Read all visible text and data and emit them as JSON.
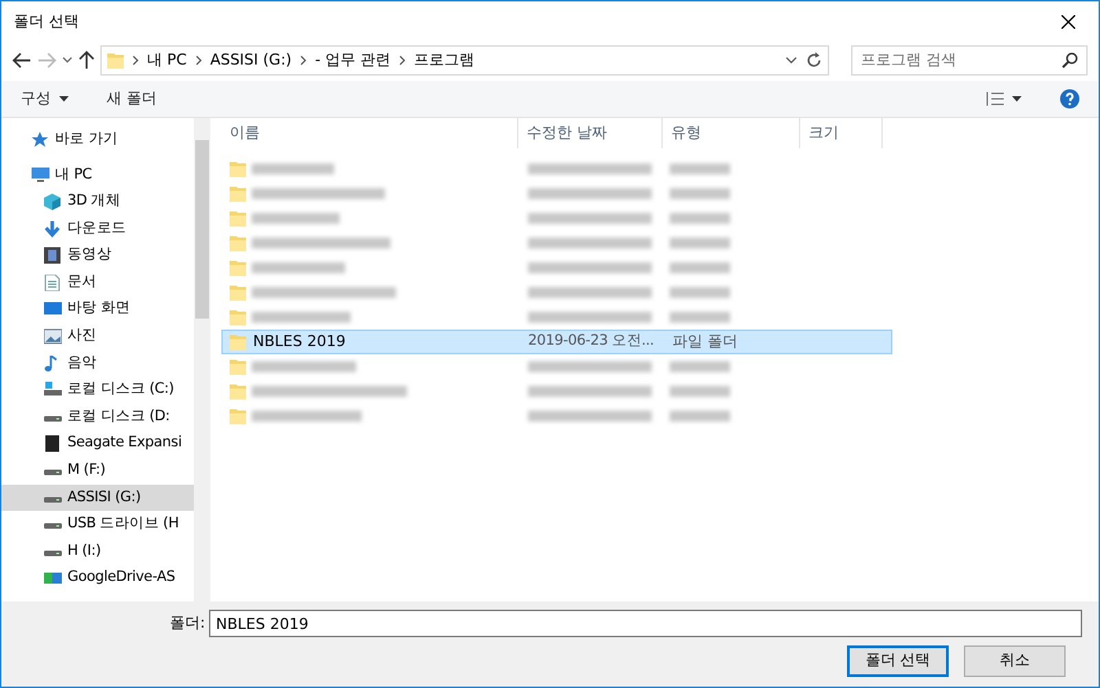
{
  "window": {
    "title": "폴더 선택"
  },
  "breadcrumb": [
    "내 PC",
    "ASSISI (G:)",
    "- 업무 관련",
    "프로그램"
  ],
  "search": {
    "placeholder": "프로그램 검색"
  },
  "toolbar": {
    "organize": "구성",
    "new_folder": "새 폴더"
  },
  "sidebar": {
    "items": [
      {
        "label": "바로 가기",
        "kind": "star",
        "selected": false
      },
      {
        "label": "내 PC",
        "kind": "pc",
        "selected": false,
        "children": [
          {
            "label": "3D 개체",
            "kind": "cube",
            "selected": false
          },
          {
            "label": "다운로드",
            "kind": "download",
            "selected": false
          },
          {
            "label": "동영상",
            "kind": "video",
            "selected": false
          },
          {
            "label": "문서",
            "kind": "doc",
            "selected": false
          },
          {
            "label": "바탕 화면",
            "kind": "desktop",
            "selected": false
          },
          {
            "label": "사진",
            "kind": "picture",
            "selected": false
          },
          {
            "label": "음악",
            "kind": "music",
            "selected": false
          },
          {
            "label": "로컬 디스크 (C:)",
            "kind": "windrive",
            "selected": false
          },
          {
            "label": "로컬 디스크 (D:",
            "kind": "drive",
            "selected": false
          },
          {
            "label": "Seagate Expansi",
            "kind": "external",
            "selected": false
          },
          {
            "label": "M (F:)",
            "kind": "drive",
            "selected": false
          },
          {
            "label": "ASSISI (G:)",
            "kind": "drive",
            "selected": true
          },
          {
            "label": "USB 드라이브 (H",
            "kind": "drive",
            "selected": false
          },
          {
            "label": "H (I:)",
            "kind": "drive",
            "selected": false
          },
          {
            "label": "GoogleDrive-AS",
            "kind": "gdrive",
            "selected": false
          }
        ]
      }
    ]
  },
  "table": {
    "columns": [
      "이름",
      "수정한 날짜",
      "유형",
      "크기"
    ],
    "rows": [
      {
        "kind": "blurred",
        "selected": false
      },
      {
        "kind": "blurred",
        "selected": false
      },
      {
        "kind": "blurred",
        "selected": false
      },
      {
        "kind": "blurred",
        "selected": false
      },
      {
        "kind": "blurred",
        "selected": false
      },
      {
        "kind": "blurred",
        "selected": false
      },
      {
        "kind": "blurred",
        "selected": false
      },
      {
        "kind": "folder",
        "name": "NBLES 2019",
        "date": "2019-06-23 오전...",
        "type": "파일 폴더",
        "selected": true
      },
      {
        "kind": "blurred",
        "selected": false
      },
      {
        "kind": "blurred",
        "selected": false
      },
      {
        "kind": "blurred",
        "selected": false
      }
    ]
  },
  "footer": {
    "label": "폴더:",
    "value": "NBLES 2019",
    "buttons": [
      {
        "label": "폴더 선택",
        "default": true
      },
      {
        "label": "취소",
        "default": false
      }
    ]
  }
}
